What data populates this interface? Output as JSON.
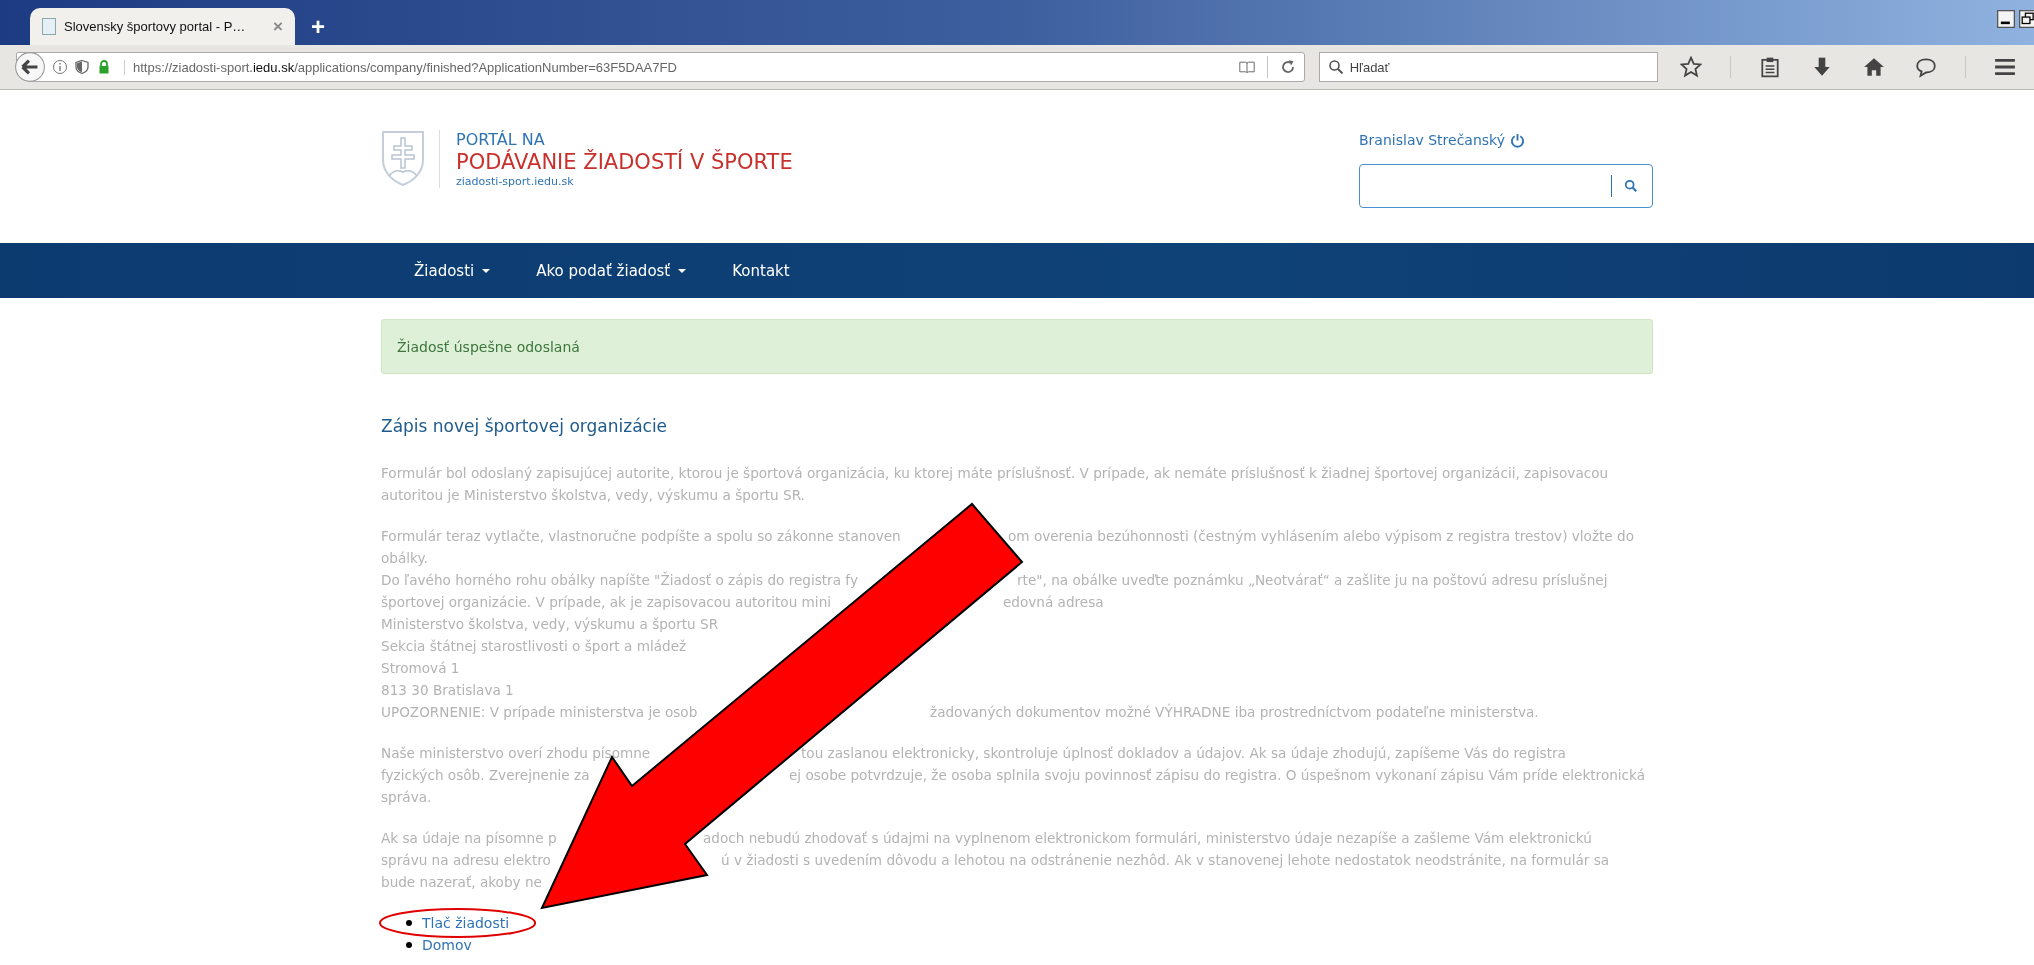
{
  "browser": {
    "tab": {
      "title": "Slovensky športovy portal - P…",
      "close": "×"
    },
    "new_tab": "+",
    "url": "https://ziadosti-sport.**iedu.sk**/applications/company/finished?ApplicationNumber=63F5DAA7FD",
    "search": {
      "placeholder": "Hľadať"
    }
  },
  "site": {
    "logo_line1": "PORTÁL NA",
    "logo_line2": "PODÁVANIE ŽIADOSTÍ V ŠPORTE",
    "logo_url": "ziadosti-sport.iedu.sk",
    "user": "Branislav Strečanský"
  },
  "nav": [
    {
      "label": "Žiadosti",
      "dropdown": true
    },
    {
      "label": "Ako podať žiadosť",
      "dropdown": true
    },
    {
      "label": "Kontakt",
      "dropdown": false
    }
  ],
  "alert": "Žiadosť úspešne odoslaná",
  "section": {
    "title": "Zápis novej športovej organizácie",
    "paragraphs": [
      [
        [
          "Formulár bol odoslaný zapisujúcej autorite, ktorou je športová organizácia, ku ktorej máte príslušnosť. V prípade, ak nemáte príslušnosť k žiadnej športovej organizácii, zapisovacou"
        ],
        [
          "autoritou je Ministerstvo školstva, vedy, výskumu a športu SR."
        ]
      ],
      [
        [
          "Formulár teraz vytlačte, vlastnoručne podpíšte a spolu so zákonne stanoven",
          "om overenia bezúhonnosti (čestným vyhlásením alebo výpisom z registra trestov) vložte do"
        ],
        [
          "obálky."
        ],
        [
          "Do ľavého horného rohu obálky napíšte \"Žiadosť o zápis do registra fy",
          "rte\", na obálke uveďte poznámku „Neotvárať“ a zašlite ju na poštovú adresu príslušnej"
        ],
        [
          "športovej organizácie. V prípade, ak je zapisovacou autoritou mini",
          "edovná adresa"
        ],
        [
          "Ministerstvo školstva, vedy, výskumu a športu SR"
        ],
        [
          "Sekcia štátnej starostlivosti o šport a mládež"
        ],
        [
          "Stromová 1"
        ],
        [
          "813 30 Bratislava 1"
        ],
        [
          "UPOZORNENIE: V prípade ministerstva je osob",
          "žadovaných dokumentov možné VÝHRADNE iba prostredníctvom podateľne ministerstva."
        ]
      ],
      [
        [
          "Naše ministerstvo overí zhodu písomne",
          "tou zaslanou elektronicky, skontroluje úplnosť dokladov a údajov. Ak sa údaje zhodujú, zapíšeme Vás do registra"
        ],
        [
          "fyzických osôb. Zverejnenie za",
          "ej osobe potvrdzuje, že osoba splnila svoju povinnosť zápisu do registra. O úspešnom vykonaní zápisu Vám príde elektronická"
        ],
        [
          "správa."
        ]
      ],
      [
        [
          "Ak sa údaje na písomne p",
          "adoch nebudú zhodovať s údajmi na vyplnenom elektronickom formulári, ministerstvo údaje nezapíše a zašleme Vám elektronickú"
        ],
        [
          "správu na adresu elektro",
          "ú v žiadosti s uvedením dôvodu a lehotou na odstránenie nezhôd. Ak v stanovenej lehote nedostatok neodstránite, na formulár sa"
        ],
        [
          "bude nazerať, akoby ne"
        ]
      ]
    ]
  },
  "links": [
    {
      "label": "Tlač žiadosti",
      "circled": true
    },
    {
      "label": "Domov",
      "circled": false
    }
  ]
}
